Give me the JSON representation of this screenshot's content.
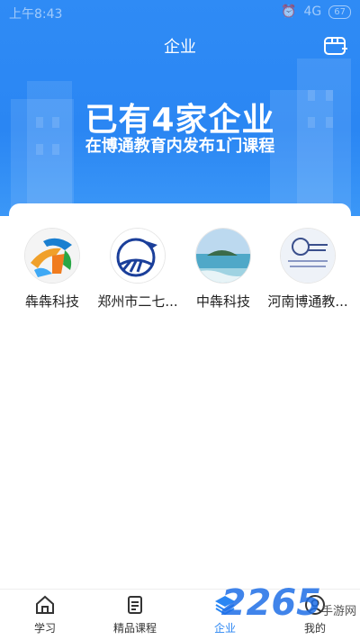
{
  "status": {
    "time": "上午8:43",
    "network": "4G",
    "battery": "67"
  },
  "header": {
    "title": "企业"
  },
  "banner": {
    "headline": "已有4家企业",
    "subline": "在博通教育内发布1门课程"
  },
  "companies": [
    {
      "name": "犇犇科技",
      "logo": "colorful-swirl-logo"
    },
    {
      "name": "郑州市二七...",
      "logo": "gear-globe-logo"
    },
    {
      "name": "中犇科技",
      "logo": "seascape-photo"
    },
    {
      "name": "河南博通教...",
      "logo": "school-seal-logo"
    }
  ],
  "tabs": [
    {
      "label": "学习",
      "icon": "home-icon",
      "active": false
    },
    {
      "label": "精品课程",
      "icon": "document-icon",
      "active": false
    },
    {
      "label": "企业",
      "icon": "layers-icon",
      "active": true
    },
    {
      "label": "我的",
      "icon": "person-icon",
      "active": false
    }
  ],
  "watermark": {
    "text": "2265",
    "suffix": "手游网"
  },
  "colors": {
    "primary": "#2a86f3",
    "text": "#222222"
  }
}
